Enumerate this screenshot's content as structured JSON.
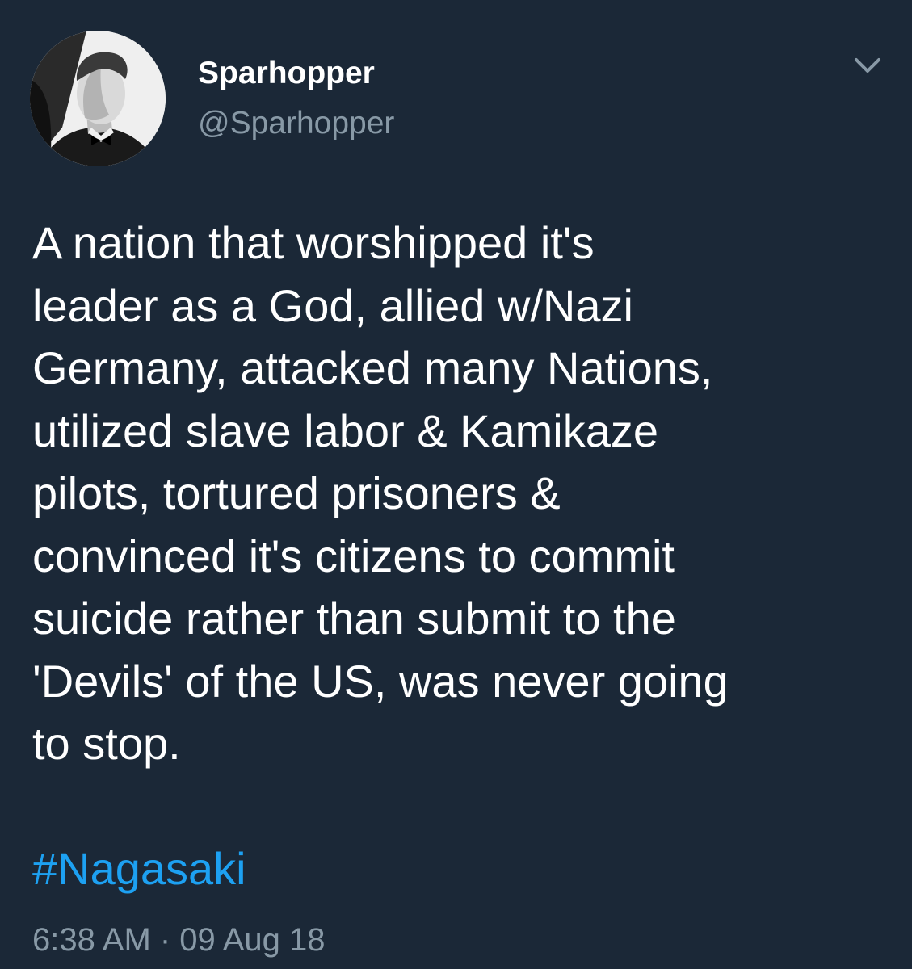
{
  "tweet": {
    "author": {
      "display_name": "Sparhopper",
      "handle": "@Sparhopper"
    },
    "body": "A nation that worshipped it's\nleader as a God, allied w/Nazi\nGermany, attacked many Nations,\nutilized slave labor & Kamikaze\npilots, tortured prisoners &\nconvinced it's citizens to commit\nsuicide rather than submit to the\n'Devils' of the US, was never going\nto stop.",
    "hashtag": "#Nagasaki",
    "timestamp": "6:38 AM · 09 Aug 18",
    "menu_icon": "chevron-down-icon"
  },
  "colors": {
    "background": "#1b2837",
    "text_primary": "#ffffff",
    "text_secondary": "#8899a6",
    "link": "#1da1f2"
  }
}
